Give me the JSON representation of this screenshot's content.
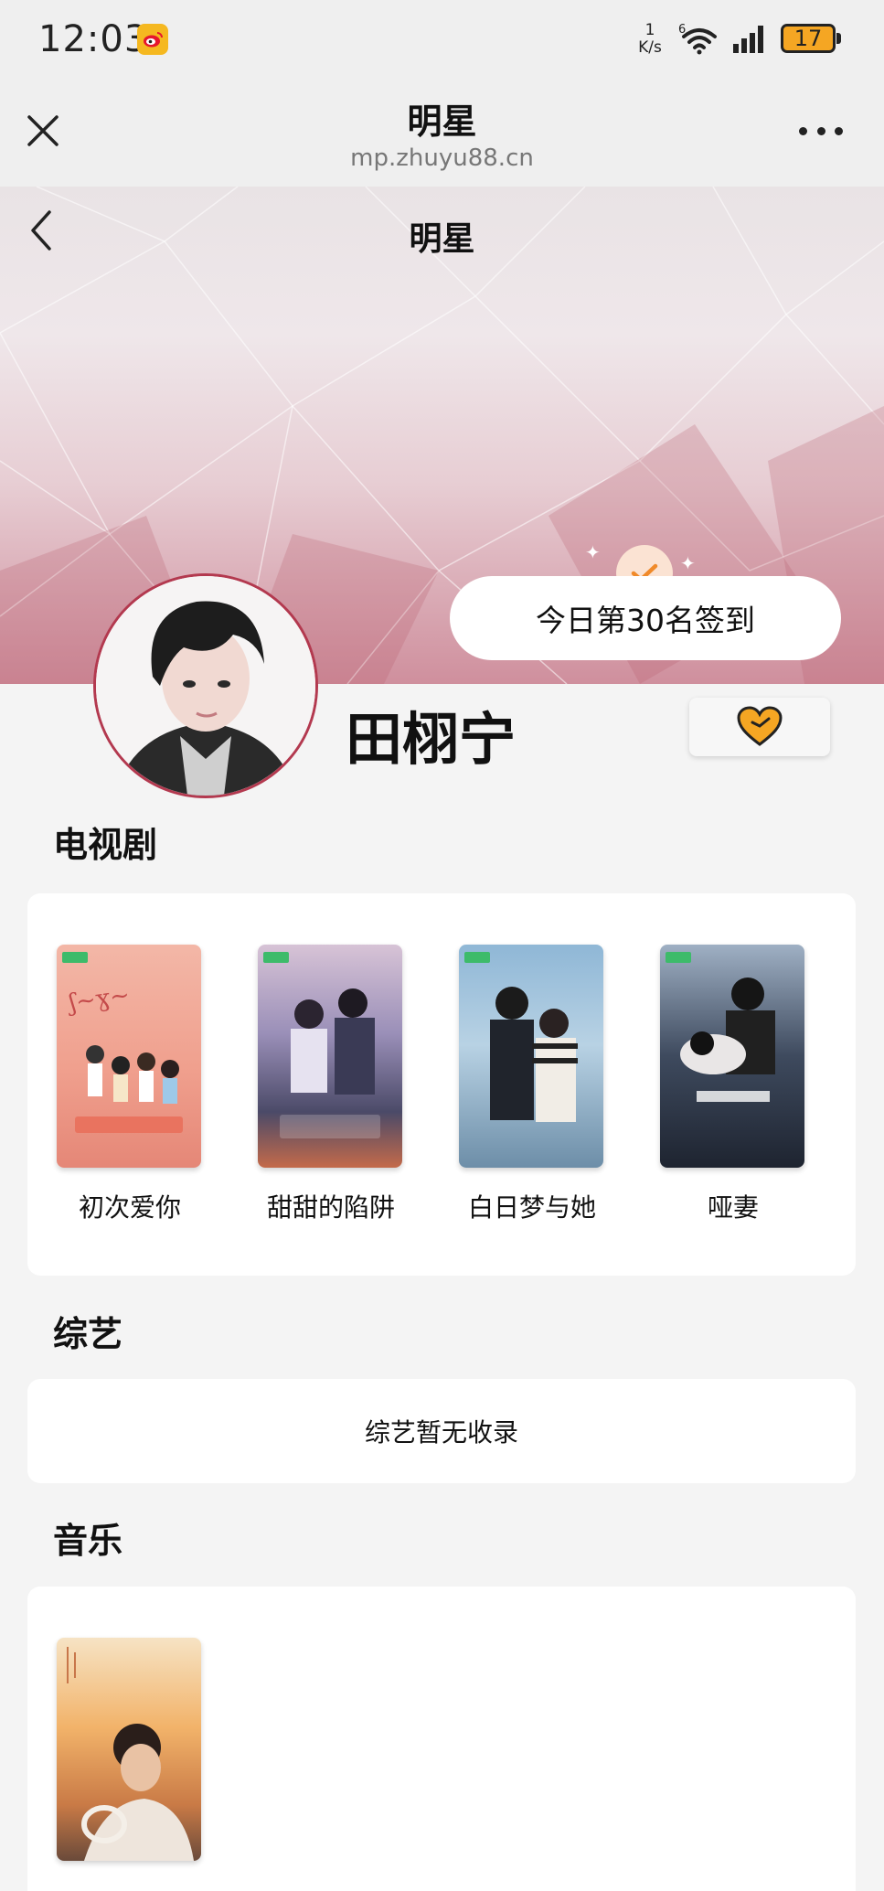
{
  "status_bar": {
    "time": "12:03",
    "net_speed_value": "1",
    "net_speed_unit": "K/s",
    "wifi_label": "6",
    "battery": "17"
  },
  "browser": {
    "title": "明星",
    "url": "mp.zhuyu88.cn"
  },
  "page": {
    "title": "明星",
    "checkin_text": "今日第30名签到"
  },
  "profile": {
    "name": "田栩宁"
  },
  "sections": {
    "tv": {
      "title": "电视剧",
      "items": [
        {
          "label": "初次爱你"
        },
        {
          "label": "甜甜的陷阱"
        },
        {
          "label": "白日梦与她"
        },
        {
          "label": "哑妻"
        }
      ]
    },
    "variety": {
      "title": "综艺",
      "empty_text": "综艺暂无收录"
    },
    "music": {
      "title": "音乐"
    }
  },
  "colors": {
    "accent": "#f5a623",
    "avatar_border": "#b3394f",
    "hero_pink": "#cf8f9d"
  },
  "icons": [
    "weibo-icon",
    "wifi-icon",
    "signal-icon",
    "close-icon",
    "more-icon",
    "back-icon",
    "check-icon",
    "heart-icon"
  ]
}
